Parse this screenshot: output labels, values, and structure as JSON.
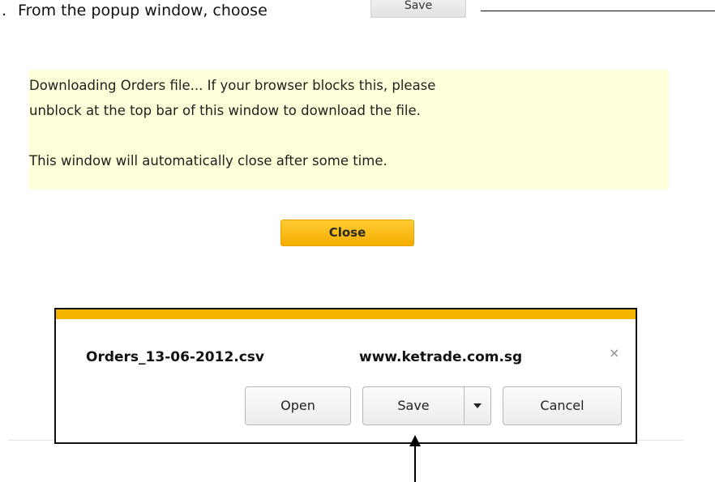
{
  "instruction": {
    "prefix": ".",
    "text": "From the popup window, choose",
    "inline_button_label": "Save"
  },
  "notice": {
    "line1": "Downloading Orders file... If your browser blocks this, please",
    "line2": "unblock at the top bar of this window to download the file.",
    "line3": "This window will automatically close after some time."
  },
  "close_button": {
    "label": "Close"
  },
  "download_bar": {
    "file_name": "Orders_13-06-2012.csv",
    "site": "www.ketrade.com.sg",
    "dismiss_glyph": "×",
    "buttons": {
      "open": "Open",
      "save": "Save",
      "cancel": "Cancel"
    },
    "dropdown_icon": "caret-down-icon"
  },
  "colors": {
    "notice_background": "#ffffd9",
    "close_button": "#f5ac00",
    "download_accent": "#f4b400"
  }
}
